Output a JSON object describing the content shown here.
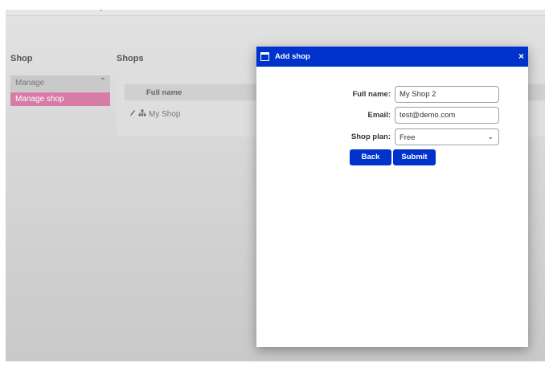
{
  "sidebar": {
    "title": "Shop",
    "group": {
      "label": "Manage",
      "chevron_icon": "chevron-up-icon"
    },
    "items": [
      {
        "label": "Manage shop",
        "active": true
      }
    ]
  },
  "main": {
    "title": "Shops",
    "table": {
      "columns": [
        "Full name"
      ],
      "rows": [
        {
          "name": "My Shop",
          "icons": [
            "edit-icon",
            "sitemap-icon"
          ]
        }
      ]
    }
  },
  "modal": {
    "title": "Add shop",
    "close_glyph": "×",
    "fields": {
      "full_name": {
        "label": "Full name:",
        "value": "My Shop 2"
      },
      "email": {
        "label": "Email:",
        "value": "test@demo.com"
      },
      "plan": {
        "label": "Shop plan:",
        "value": "Free"
      }
    },
    "buttons": {
      "back": "Back",
      "submit": "Submit"
    }
  },
  "colors": {
    "accent": "#0033cc",
    "sidebar_active": "#d77ba7",
    "overlay_bg": "#dcdcdc"
  }
}
